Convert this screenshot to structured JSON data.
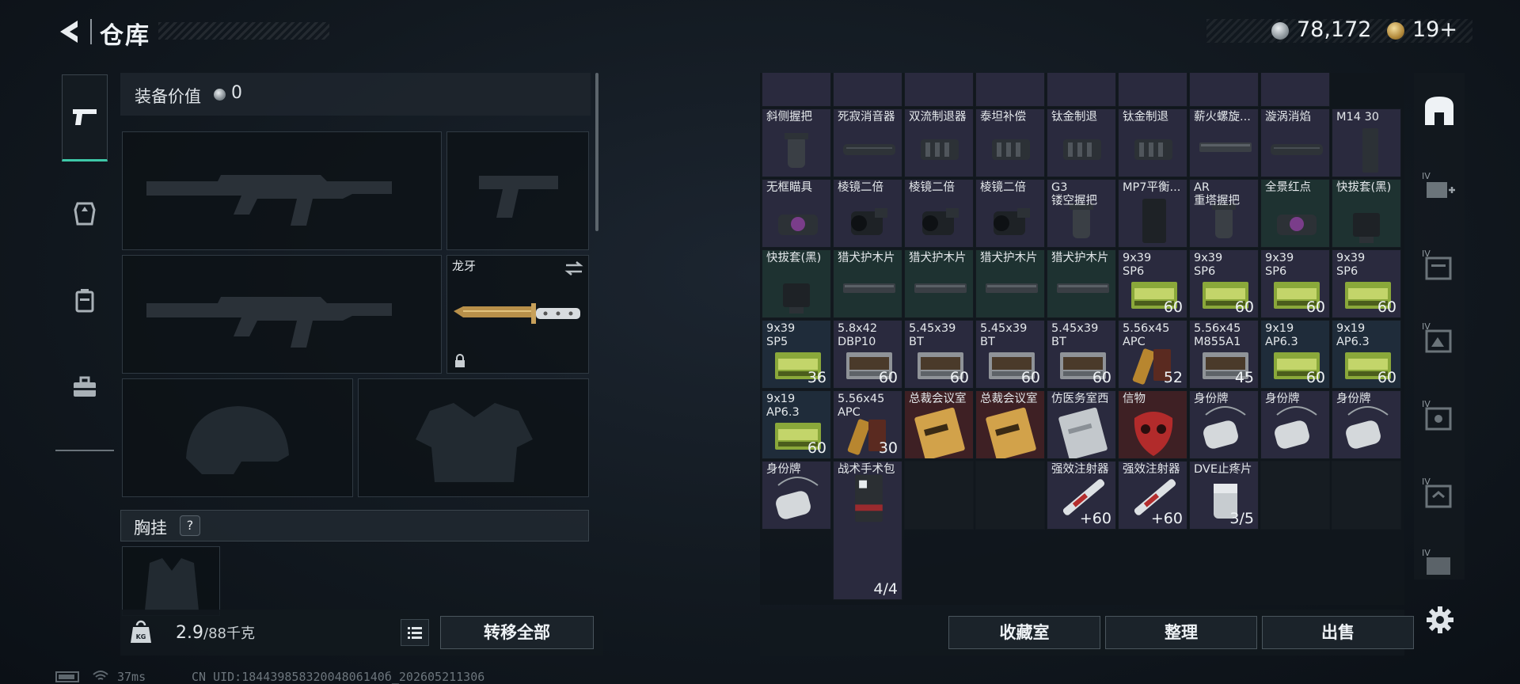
{
  "header": {
    "title": "仓库",
    "silver_amount": "78,172",
    "gold_amount": "19+"
  },
  "loadout": {
    "value_label": "装备价值",
    "value_amount": "0",
    "knife_name": "龙牙",
    "vest_label": "胸挂",
    "help_mark": "?",
    "weight_current": "2.9",
    "weight_max": "/88千克",
    "weight_icon_text": "KG",
    "transfer_all": "转移全部"
  },
  "storage": {
    "rows": [
      [
        {
          "name": "",
          "count": "",
          "bg": "purple",
          "art": "part"
        },
        {
          "name": "",
          "count": "",
          "bg": "purple",
          "art": "part"
        },
        {
          "name": "",
          "count": "",
          "bg": "purple",
          "art": "part"
        },
        {
          "name": "",
          "count": "",
          "bg": "purple",
          "art": "part"
        },
        {
          "name": "",
          "count": "",
          "bg": "purple",
          "art": "part"
        },
        {
          "name": "",
          "count": "",
          "bg": "purple",
          "art": "tri"
        },
        {
          "name": "",
          "count": "",
          "bg": "purple",
          "art": "part"
        },
        {
          "name": "",
          "count": "",
          "bg": "purple",
          "art": "tri"
        }
      ],
      [
        {
          "name": "斜侧握把",
          "count": "",
          "bg": "purple",
          "art": "grip"
        },
        {
          "name": "死寂消音器",
          "count": "",
          "bg": "purple",
          "art": "silencer"
        },
        {
          "name": "双流制退器",
          "count": "",
          "bg": "purple",
          "art": "brake"
        },
        {
          "name": "泰坦补偿",
          "count": "",
          "bg": "purple",
          "art": "brake"
        },
        {
          "name": "钛金制退",
          "count": "",
          "bg": "purple",
          "art": "brake"
        },
        {
          "name": "钛金制退",
          "count": "",
          "bg": "purple",
          "art": "brake"
        },
        {
          "name": "薪火螺旋...",
          "count": "",
          "bg": "purple",
          "art": "rail"
        },
        {
          "name": "漩涡消焰",
          "count": "",
          "bg": "purple",
          "art": "silencer"
        },
        {
          "name": "M14 30",
          "count": "",
          "bg": "purple",
          "art": "mag"
        }
      ],
      [
        {
          "name": "无框瞄具",
          "count": "",
          "bg": "purple",
          "art": "sight"
        },
        {
          "name": "棱镜二倍",
          "count": "",
          "bg": "purple",
          "art": "scope"
        },
        {
          "name": "棱镜二倍",
          "count": "",
          "bg": "purple",
          "art": "scope"
        },
        {
          "name": "棱镜二倍",
          "count": "",
          "bg": "purple",
          "art": "scope"
        },
        {
          "name": "G3\n镂空握把",
          "count": "",
          "bg": "purple",
          "art": "grip"
        },
        {
          "name": "MP7平衡...",
          "count": "",
          "bg": "purple",
          "art": "stock"
        },
        {
          "name": "AR\n重塔握把",
          "count": "",
          "bg": "purple",
          "art": "grip"
        },
        {
          "name": "全景红点",
          "count": "",
          "bg": "green",
          "art": "sight"
        },
        {
          "name": "快拔套(黑)",
          "count": "",
          "bg": "green",
          "art": "mount"
        }
      ],
      [
        {
          "name": "快拔套(黑)",
          "count": "",
          "bg": "green",
          "art": "mount"
        },
        {
          "name": "猎犬护木片",
          "count": "",
          "bg": "green",
          "art": "rail"
        },
        {
          "name": "猎犬护木片",
          "count": "",
          "bg": "green",
          "art": "rail"
        },
        {
          "name": "猎犬护木片",
          "count": "",
          "bg": "green",
          "art": "rail"
        },
        {
          "name": "猎犬护木片",
          "count": "",
          "bg": "green",
          "art": "rail"
        },
        {
          "name": "9x39\nSP6",
          "count": "60",
          "bg": "purple",
          "art": "ammo-green"
        },
        {
          "name": "9x39\nSP6",
          "count": "60",
          "bg": "purple",
          "art": "ammo-green"
        },
        {
          "name": "9x39\nSP6",
          "count": "60",
          "bg": "purple",
          "art": "ammo-green"
        },
        {
          "name": "9x39\nSP6",
          "count": "60",
          "bg": "purple",
          "art": "ammo-green"
        }
      ],
      [
        {
          "name": "9x39\nSP5",
          "count": "36",
          "bg": "blue",
          "art": "ammo-green"
        },
        {
          "name": "5.8x42\nDBP10",
          "count": "60",
          "bg": "purple",
          "art": "ammo-gray"
        },
        {
          "name": "5.45x39\nBT",
          "count": "60",
          "bg": "purple",
          "art": "ammo-gray"
        },
        {
          "name": "5.45x39\nBT",
          "count": "60",
          "bg": "purple",
          "art": "ammo-gray"
        },
        {
          "name": "5.45x39\nBT",
          "count": "60",
          "bg": "purple",
          "art": "ammo-gray"
        },
        {
          "name": "5.56x45\nAPC",
          "count": "52",
          "bg": "purple",
          "art": "ammo-brass"
        },
        {
          "name": "5.56x45\nM855A1",
          "count": "45",
          "bg": "purple",
          "art": "ammo-gray"
        },
        {
          "name": "9x19\nAP6.3",
          "count": "60",
          "bg": "blue",
          "art": "ammo-green"
        },
        {
          "name": "9x19\nAP6.3",
          "count": "60",
          "bg": "blue",
          "art": "ammo-green"
        }
      ],
      [
        {
          "name": "9x19\nAP6.3",
          "count": "60",
          "bg": "blue",
          "art": "ammo-green"
        },
        {
          "name": "5.56x45\nAPC",
          "count": "30",
          "bg": "purple",
          "art": "ammo-brass"
        },
        {
          "name": "总裁会议室",
          "count": "",
          "bg": "red",
          "art": "card"
        },
        {
          "name": "总裁会议室",
          "count": "",
          "bg": "red",
          "art": "card"
        },
        {
          "name": "仿医务室西",
          "count": "",
          "bg": "purple",
          "art": "card-clear"
        },
        {
          "name": "信物",
          "count": "",
          "bg": "red",
          "art": "mask"
        },
        {
          "name": "身份牌",
          "count": "",
          "bg": "purple",
          "art": "tag"
        },
        {
          "name": "身份牌",
          "count": "",
          "bg": "purple",
          "art": "tag"
        },
        {
          "name": "身份牌",
          "count": "",
          "bg": "purple",
          "art": "tag"
        }
      ],
      [
        {
          "name": "身份牌",
          "count": "",
          "bg": "purple",
          "art": "tag"
        },
        {
          "name": "战术手术包",
          "count": "4/4",
          "bg": "purple",
          "art": "medkit"
        },
        {
          "name": "",
          "count": "",
          "bg": "empty",
          "art": ""
        },
        {
          "name": "",
          "count": "",
          "bg": "empty",
          "art": ""
        },
        {
          "name": "强效注射器",
          "count": "+60",
          "bg": "purple",
          "art": "syringe"
        },
        {
          "name": "强效注射器",
          "count": "+60",
          "bg": "purple",
          "art": "syringe"
        },
        {
          "name": "DVE止疼片",
          "count": "3/5",
          "bg": "purple",
          "art": "pill"
        },
        {
          "name": "",
          "count": "",
          "bg": "empty",
          "art": ""
        },
        {
          "name": "",
          "count": "",
          "bg": "empty",
          "art": ""
        }
      ]
    ]
  },
  "actions": {
    "collection": "收藏室",
    "sort": "整理",
    "sell": "出售"
  },
  "right_nav": {
    "tier_label": "IV"
  },
  "status_bar": {
    "ping": "37ms",
    "uid": "CN UID:18443985832004806140б_202605211306"
  }
}
